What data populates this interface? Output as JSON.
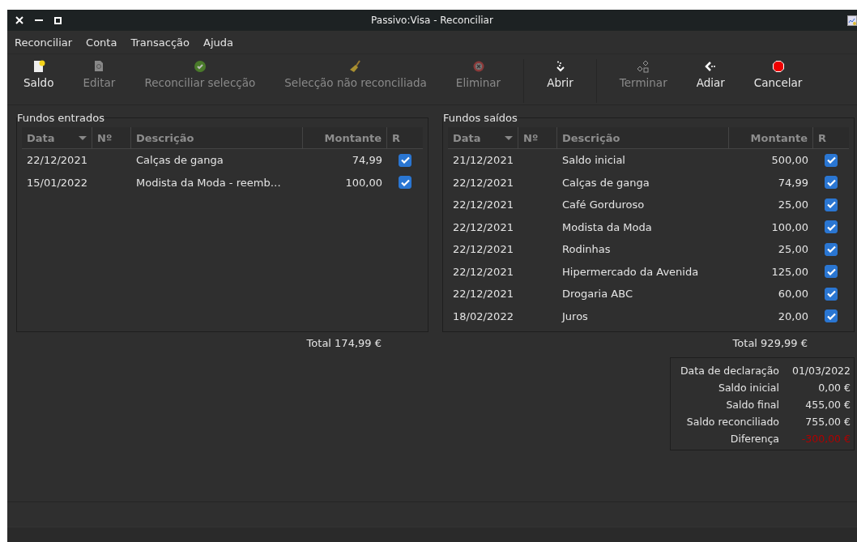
{
  "window": {
    "title": "Passivo:Visa - Reconciliar"
  },
  "menu": [
    "Reconciliar",
    "Conta",
    "Transacção",
    "Ajuda"
  ],
  "toolbar": [
    {
      "kind": "button",
      "label": "Saldo",
      "disabled": false
    },
    {
      "kind": "button",
      "label": "Editar",
      "disabled": true
    },
    {
      "kind": "button",
      "label": "Reconciliar selecção",
      "disabled": true
    },
    {
      "kind": "button",
      "label": "Selecção não reconciliada",
      "disabled": true
    },
    {
      "kind": "button",
      "label": "Eliminar",
      "disabled": true
    },
    {
      "kind": "separator"
    },
    {
      "kind": "button",
      "label": "Abrir",
      "disabled": false
    },
    {
      "kind": "separator"
    },
    {
      "kind": "button",
      "label": "Terminar",
      "disabled": true
    },
    {
      "kind": "button",
      "label": "Adiar",
      "disabled": false
    },
    {
      "kind": "button",
      "label": "Cancelar",
      "disabled": false
    }
  ],
  "panels": [
    {
      "title": "Fundos entrados",
      "columns": [
        "Data",
        "Nº",
        "Descrição",
        "Montante",
        "R"
      ],
      "rows": [
        {
          "date": "22/12/2021",
          "description": "Calças de ganga",
          "amount": "74,99",
          "checked": true
        },
        {
          "date": "15/01/2022",
          "description": "Modista da Moda - reemb…",
          "amount": "100,00",
          "checked": true
        }
      ],
      "total": "Total 174,99 €"
    },
    {
      "title": "Fundos saídos",
      "columns": [
        "Data",
        "Nº",
        "Descrição",
        "Montante",
        "R"
      ],
      "rows": [
        {
          "date": "21/12/2021",
          "description": "Saldo inicial",
          "amount": "500,00",
          "checked": true
        },
        {
          "date": "22/12/2021",
          "description": "Calças de ganga",
          "amount": "74,99",
          "checked": true
        },
        {
          "date": "22/12/2021",
          "description": "Café Gorduroso",
          "amount": "25,00",
          "checked": true
        },
        {
          "date": "22/12/2021",
          "description": "Modista da Moda",
          "amount": "100,00",
          "checked": true
        },
        {
          "date": "22/12/2021",
          "description": "Rodinhas",
          "amount": "25,00",
          "checked": true
        },
        {
          "date": "22/12/2021",
          "description": "Hipermercado da Avenida",
          "amount": "125,00",
          "checked": true
        },
        {
          "date": "22/12/2021",
          "description": "Drogaria ABC",
          "amount": "60,00",
          "checked": true
        },
        {
          "date": "18/02/2022",
          "description": "Juros",
          "amount": "20,00",
          "checked": true
        }
      ],
      "total": "Total 929,99 €"
    }
  ],
  "summary": [
    {
      "label": "Data de declaração",
      "value": "01/03/2022",
      "negative": false
    },
    {
      "label": "Saldo inicial",
      "value": "0,00 €",
      "negative": false
    },
    {
      "label": "Saldo final",
      "value": "455,00 €",
      "negative": false
    },
    {
      "label": "Saldo reconciliado",
      "value": "755,00 €",
      "negative": false
    },
    {
      "label": "Diferença",
      "value": "-300,00 €",
      "negative": true
    }
  ]
}
